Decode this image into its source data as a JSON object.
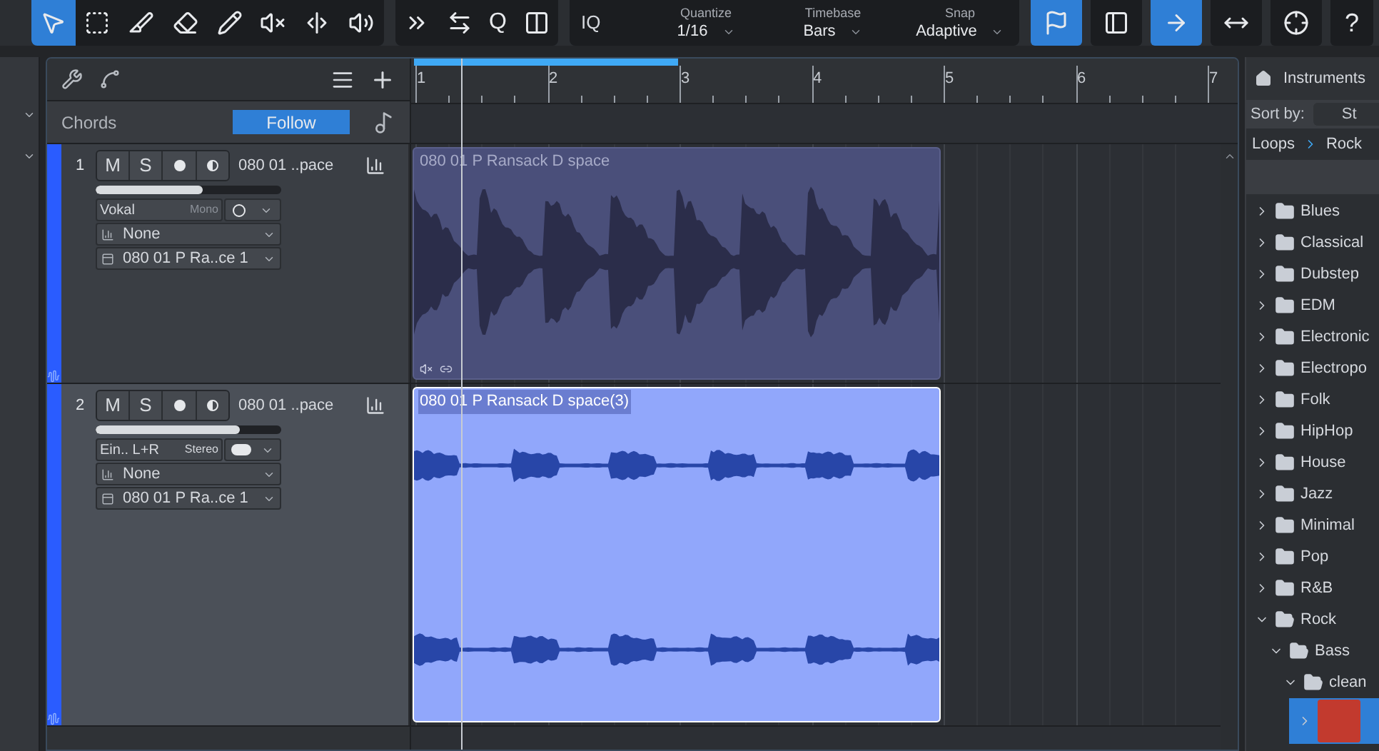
{
  "toolbar": {
    "tools": [
      {
        "selected": true
      },
      {
        "selected": false
      },
      {
        "selected": false
      },
      {
        "selected": false
      },
      {
        "selected": false
      },
      {
        "selected": false
      },
      {
        "selected": false
      },
      {
        "selected": false
      }
    ],
    "edit_group": {
      "quantize_key": "Q"
    },
    "iq": "IQ",
    "selectors": [
      {
        "label": "Quantize",
        "value": "1/16"
      },
      {
        "label": "Timebase",
        "value": "Bars"
      },
      {
        "label": "Snap",
        "value": "Adaptive"
      }
    ],
    "view_buttons": [
      {
        "selected": true
      },
      {
        "selected": false
      },
      {
        "selected": true
      },
      {
        "selected": false
      },
      {
        "selected": false
      }
    ],
    "help": "?"
  },
  "arrange": {
    "chords": {
      "label": "Chords",
      "follow": "Follow"
    },
    "ruler": {
      "bars": [
        "1",
        "2",
        "3",
        "4",
        "5",
        "6",
        "7"
      ]
    },
    "tracks": [
      {
        "number": "1",
        "mute": "M",
        "solo": "S",
        "name": "080 01 ..pace",
        "selected": false,
        "level": 0.58,
        "input": "Vokal",
        "channel": "Mono",
        "stereo": false,
        "insert": "None",
        "output": "080 01 P Ra..ce 1",
        "clip": {
          "name": "080 01 P Ransack D space",
          "selected": false
        }
      },
      {
        "number": "2",
        "mute": "M",
        "solo": "S",
        "name": "080 01 ..pace",
        "selected": true,
        "level": 0.78,
        "input": "Ein.. L+R",
        "channel": "Stereo",
        "stereo": true,
        "insert": "None",
        "output": "080 01 P Ra..ce 1",
        "clip": {
          "name": "080 01 P Ransack D space(3)",
          "selected": true
        }
      }
    ]
  },
  "browser": {
    "tab": "Instruments",
    "sort_label": "Sort by:",
    "sort_value": "St",
    "path": [
      "Loops",
      "Rock"
    ],
    "tree": [
      {
        "label": "Blues",
        "expanded": false
      },
      {
        "label": "Classical",
        "expanded": false
      },
      {
        "label": "Dubstep",
        "expanded": false
      },
      {
        "label": "EDM",
        "expanded": false
      },
      {
        "label": "Electronic",
        "expanded": false
      },
      {
        "label": "Electropo",
        "expanded": false
      },
      {
        "label": "Folk",
        "expanded": false
      },
      {
        "label": "HipHop",
        "expanded": false
      },
      {
        "label": "House",
        "expanded": false
      },
      {
        "label": "Jazz",
        "expanded": false
      },
      {
        "label": "Minimal",
        "expanded": false
      },
      {
        "label": "Pop",
        "expanded": false
      },
      {
        "label": "R&B",
        "expanded": false
      },
      {
        "label": "Rock",
        "expanded": true,
        "children": [
          {
            "label": "Bass",
            "expanded": true,
            "children": [
              {
                "label": "clean",
                "expanded": true,
                "children": [
                  {
                    "kind": "loop",
                    "selected": true,
                    "expanded": false
                  }
                ]
              }
            ]
          }
        ]
      }
    ]
  }
}
